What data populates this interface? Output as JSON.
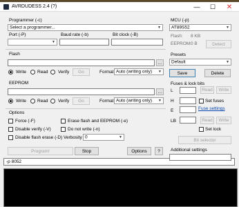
{
  "window": {
    "title": "AVRDUDESS 2.4 (?)",
    "min_glyph": "—",
    "max_glyph": "☐",
    "close_glyph": "✕"
  },
  "programmer": {
    "label": "Programmer (-c)",
    "selected": "Select a programmer...",
    "port_label": "Port (-P)",
    "port_value": "",
    "baud_label": "Baud rate (-b)",
    "baud_value": "",
    "bitclock_label": "Bit clock (-B)",
    "bitclock_value": ""
  },
  "flash": {
    "label": "Flash",
    "path": "",
    "browse_label": "...",
    "write_label": "Write",
    "read_label": "Read",
    "verify_label": "Verify",
    "go_label": "Go",
    "format_label": "Format",
    "format_value": "Auto (writing only)"
  },
  "eeprom": {
    "label": "EEPROM",
    "path": "",
    "browse_label": "...",
    "write_label": "Write",
    "read_label": "Read",
    "verify_label": "Verify",
    "go_label": "Go",
    "format_label": "Format",
    "format_value": "Auto (writing only)"
  },
  "options": {
    "label": "Options",
    "force": "Force (-F)",
    "disable_verify": "Disable verify (-V)",
    "disable_flash_erase": "Disable flash erase (-D)",
    "erase_flash_eeprom": "Erase flash and EEPROM (-e)",
    "do_not_write": "Do not write (-n)",
    "verbosity_label": "Verbosity",
    "verbosity_value": "0"
  },
  "actions": {
    "program_label": "Program!",
    "stop_label": "Stop",
    "options_label": "Options",
    "help_label": "?"
  },
  "command_line": "-p 8052",
  "mcu": {
    "label": "MCU (-p)",
    "selected": "AT89S52",
    "flash_label": "Flash:",
    "flash_value": "8 KB",
    "eeprom_label": "EEPROM:",
    "eeprom_value": "0 B",
    "detect_label": "Detect"
  },
  "presets": {
    "label": "Presets",
    "selected": "Default",
    "save_label": "Save",
    "delete_label": "Delete"
  },
  "fuses": {
    "label": "Fuses & lock bits",
    "l_label": "L",
    "h_label": "H",
    "e_label": "E",
    "lb_label": "LB",
    "read_label": "Read",
    "write_label": "Write",
    "set_fuses_label": "Set fuses",
    "fuse_settings_link": "Fuse settings",
    "set_lock_label": "Set lock",
    "bit_selector_label": "Bit selector"
  },
  "additional": {
    "label": "Additional settings",
    "value": ""
  }
}
